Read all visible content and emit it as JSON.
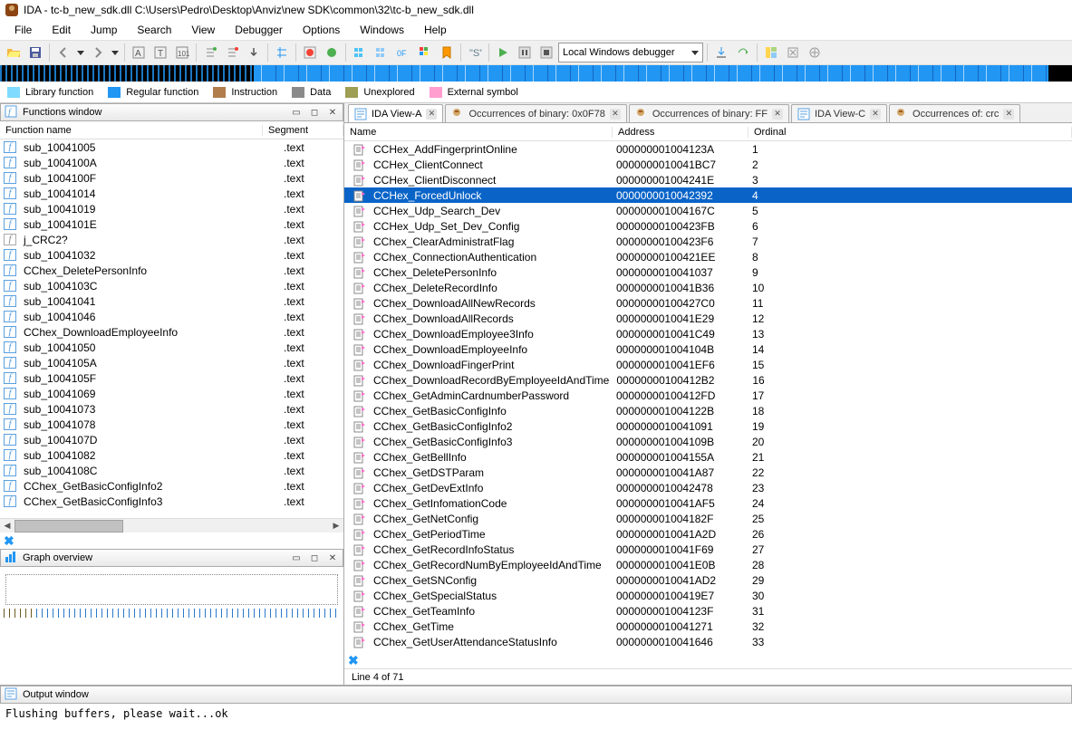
{
  "title": "IDA - tc-b_new_sdk.dll C:\\Users\\Pedro\\Desktop\\Anviz\\new SDK\\common\\32\\tc-b_new_sdk.dll",
  "menu": [
    "File",
    "Edit",
    "Jump",
    "Search",
    "View",
    "Debugger",
    "Options",
    "Windows",
    "Help"
  ],
  "debugger_combo": "Local Windows debugger",
  "legend": [
    {
      "label": "Library function",
      "color": "#7fdbff"
    },
    {
      "label": "Regular function",
      "color": "#2196f3"
    },
    {
      "label": "Instruction",
      "color": "#b07d4b"
    },
    {
      "label": "Data",
      "color": "#8a8a8a"
    },
    {
      "label": "Unexplored",
      "color": "#9e9e54"
    },
    {
      "label": "External symbol",
      "color": "#ff9ecf"
    }
  ],
  "functions_window": {
    "title": "Functions window",
    "col_name": "Function name",
    "col_seg": "Segment",
    "rows": [
      {
        "n": "sub_10041005",
        "s": ".text",
        "t": "f"
      },
      {
        "n": "sub_1004100A",
        "s": ".text",
        "t": "f"
      },
      {
        "n": "sub_1004100F",
        "s": ".text",
        "t": "f"
      },
      {
        "n": "sub_10041014",
        "s": ".text",
        "t": "f"
      },
      {
        "n": "sub_10041019",
        "s": ".text",
        "t": "f"
      },
      {
        "n": "sub_1004101E",
        "s": ".text",
        "t": "f"
      },
      {
        "n": "j_CRC2?",
        "s": ".text",
        "t": "j"
      },
      {
        "n": "sub_10041032",
        "s": ".text",
        "t": "f"
      },
      {
        "n": "CChex_DeletePersonInfo",
        "s": ".text",
        "t": "f"
      },
      {
        "n": "sub_1004103C",
        "s": ".text",
        "t": "f"
      },
      {
        "n": "sub_10041041",
        "s": ".text",
        "t": "f"
      },
      {
        "n": "sub_10041046",
        "s": ".text",
        "t": "f"
      },
      {
        "n": "CChex_DownloadEmployeeInfo",
        "s": ".text",
        "t": "f"
      },
      {
        "n": "sub_10041050",
        "s": ".text",
        "t": "f"
      },
      {
        "n": "sub_1004105A",
        "s": ".text",
        "t": "f"
      },
      {
        "n": "sub_1004105F",
        "s": ".text",
        "t": "f"
      },
      {
        "n": "sub_10041069",
        "s": ".text",
        "t": "f"
      },
      {
        "n": "sub_10041073",
        "s": ".text",
        "t": "f"
      },
      {
        "n": "sub_10041078",
        "s": ".text",
        "t": "f"
      },
      {
        "n": "sub_1004107D",
        "s": ".text",
        "t": "f"
      },
      {
        "n": "sub_10041082",
        "s": ".text",
        "t": "f"
      },
      {
        "n": "sub_1004108C",
        "s": ".text",
        "t": "f"
      },
      {
        "n": "CChex_GetBasicConfigInfo2",
        "s": ".text",
        "t": "f"
      },
      {
        "n": "CChex_GetBasicConfigInfo3",
        "s": ".text",
        "t": "f"
      }
    ]
  },
  "graph_overview": {
    "title": "Graph overview"
  },
  "tabs": [
    {
      "label": "IDA View-A",
      "kind": "view"
    },
    {
      "label": "Occurrences of binary: 0x0F78",
      "kind": "search"
    },
    {
      "label": "Occurrences of binary: FF",
      "kind": "search"
    },
    {
      "label": "IDA View-C",
      "kind": "view"
    },
    {
      "label": "Occurrences of: crc",
      "kind": "search"
    }
  ],
  "exports": {
    "col_name": "Name",
    "col_addr": "Address",
    "col_ord": "Ordinal",
    "selected": 3,
    "rows": [
      {
        "n": "CCHex_AddFingerprintOnline",
        "a": "000000001004123A",
        "o": "1"
      },
      {
        "n": "CCHex_ClientConnect",
        "a": "0000000010041BC7",
        "o": "2"
      },
      {
        "n": "CCHex_ClientDisconnect",
        "a": "000000001004241E",
        "o": "3"
      },
      {
        "n": "CCHex_ForcedUnlock",
        "a": "0000000010042392",
        "o": "4"
      },
      {
        "n": "CCHex_Udp_Search_Dev",
        "a": "000000001004167C",
        "o": "5"
      },
      {
        "n": "CCHex_Udp_Set_Dev_Config",
        "a": "00000000100423FB",
        "o": "6"
      },
      {
        "n": "CChex_ClearAdministratFlag",
        "a": "00000000100423F6",
        "o": "7"
      },
      {
        "n": "CChex_ConnectionAuthentication",
        "a": "00000000100421EE",
        "o": "8"
      },
      {
        "n": "CChex_DeletePersonInfo",
        "a": "0000000010041037",
        "o": "9"
      },
      {
        "n": "CChex_DeleteRecordInfo",
        "a": "0000000010041B36",
        "o": "10"
      },
      {
        "n": "CChex_DownloadAllNewRecords",
        "a": "00000000100427C0",
        "o": "11"
      },
      {
        "n": "CChex_DownloadAllRecords",
        "a": "0000000010041E29",
        "o": "12"
      },
      {
        "n": "CChex_DownloadEmployee3Info",
        "a": "0000000010041C49",
        "o": "13"
      },
      {
        "n": "CChex_DownloadEmployeeInfo",
        "a": "000000001004104B",
        "o": "14"
      },
      {
        "n": "CChex_DownloadFingerPrint",
        "a": "0000000010041EF6",
        "o": "15"
      },
      {
        "n": "CChex_DownloadRecordByEmployeeIdAndTime",
        "a": "00000000100412B2",
        "o": "16"
      },
      {
        "n": "CChex_GetAdminCardnumberPassword",
        "a": "00000000100412FD",
        "o": "17"
      },
      {
        "n": "CChex_GetBasicConfigInfo",
        "a": "000000001004122B",
        "o": "18"
      },
      {
        "n": "CChex_GetBasicConfigInfo2",
        "a": "0000000010041091",
        "o": "19"
      },
      {
        "n": "CChex_GetBasicConfigInfo3",
        "a": "000000001004109B",
        "o": "20"
      },
      {
        "n": "CChex_GetBellInfo",
        "a": "000000001004155A",
        "o": "21"
      },
      {
        "n": "CChex_GetDSTParam",
        "a": "0000000010041A87",
        "o": "22"
      },
      {
        "n": "CChex_GetDevExtInfo",
        "a": "0000000010042478",
        "o": "23"
      },
      {
        "n": "CChex_GetInfomationCode",
        "a": "0000000010041AF5",
        "o": "24"
      },
      {
        "n": "CChex_GetNetConfig",
        "a": "000000001004182F",
        "o": "25"
      },
      {
        "n": "CChex_GetPeriodTime",
        "a": "0000000010041A2D",
        "o": "26"
      },
      {
        "n": "CChex_GetRecordInfoStatus",
        "a": "0000000010041F69",
        "o": "27"
      },
      {
        "n": "CChex_GetRecordNumByEmployeeIdAndTime",
        "a": "0000000010041E0B",
        "o": "28"
      },
      {
        "n": "CChex_GetSNConfig",
        "a": "0000000010041AD2",
        "o": "29"
      },
      {
        "n": "CChex_GetSpecialStatus",
        "a": "00000000100419E7",
        "o": "30"
      },
      {
        "n": "CChex_GetTeamInfo",
        "a": "000000001004123F",
        "o": "31"
      },
      {
        "n": "CChex_GetTime",
        "a": "0000000010041271",
        "o": "32"
      },
      {
        "n": "CChex_GetUserAttendanceStatusInfo",
        "a": "0000000010041646",
        "o": "33"
      }
    ]
  },
  "status_line": "Line 4 of 71",
  "output": {
    "title": "Output window",
    "text": "Flushing buffers, please wait...ok"
  }
}
